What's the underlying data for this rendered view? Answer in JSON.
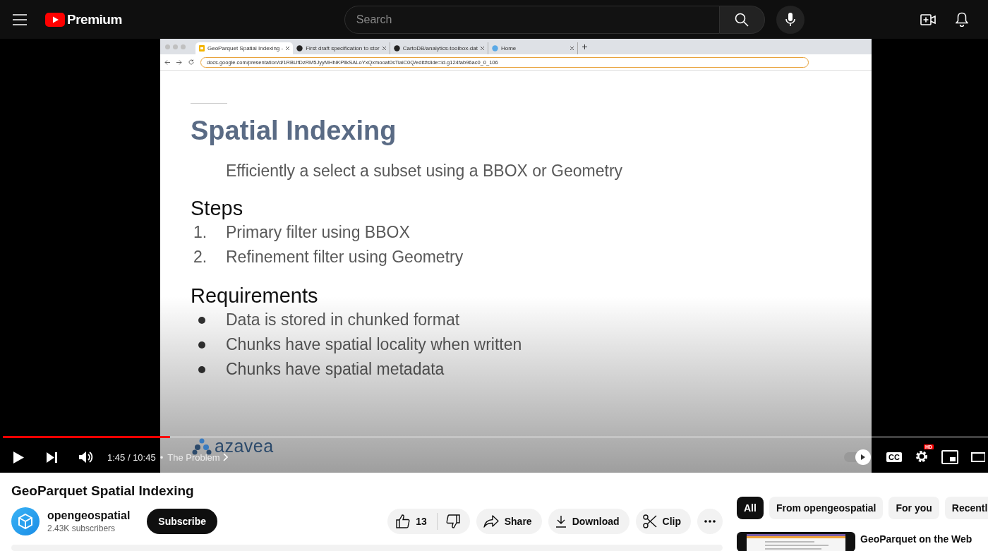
{
  "masthead": {
    "logo_text": "Premium",
    "search": {
      "placeholder": "Search"
    }
  },
  "player": {
    "browser": {
      "tabs": [
        {
          "title": "GeoParquet Spatial Indexing -",
          "selected": true
        },
        {
          "title": "First draft specification to stor",
          "selected": false
        },
        {
          "title": "CartoDB/analytics-toolbox-dat",
          "selected": false
        },
        {
          "title": "Home",
          "selected": false
        }
      ],
      "address": "docs.google.com/presentation/d/1RBUfDzRM5JyyMHhiKPllkSALoYxQxmooat0sTiaiC0Q/edit#slide=id.g124fab96ac0_0_106"
    },
    "slide": {
      "title": "Spatial Indexing",
      "subtitle": "Efficiently a select a subset using a BBOX or Geometry",
      "sections": [
        {
          "heading": "Steps",
          "kind": "numbered",
          "items": [
            {
              "marker": "1.",
              "text": "Primary filter using BBOX"
            },
            {
              "marker": "2.",
              "text": "Refinement filter using Geometry"
            }
          ]
        },
        {
          "heading": "Requirements",
          "kind": "bulleted",
          "items": [
            {
              "text": "Data is stored in chunked format"
            },
            {
              "text": "Chunks have spatial locality when written"
            },
            {
              "text": "Chunks have spatial metadata"
            }
          ]
        }
      ],
      "logo_text": "azavea"
    },
    "progress": {
      "level": 0.17
    },
    "time": "1:45 / 10:45",
    "chapter_separator": "•",
    "chapter": "The Problem",
    "autoplay_on": true,
    "captions_label": "CC",
    "quality_badge": "HD"
  },
  "video": {
    "title": "GeoParquet Spatial Indexing",
    "channel": {
      "name": "opengeospatial",
      "subscribers": "2.43K subscribers"
    },
    "subscribe_label": "Subscribe",
    "likes": "13",
    "actions": [
      {
        "kind": "share",
        "label": "Share"
      },
      {
        "kind": "download",
        "label": "Download"
      },
      {
        "kind": "clip",
        "label": "Clip"
      }
    ]
  },
  "related": {
    "chips": [
      {
        "label": "All",
        "selected": true
      },
      {
        "label": "From opengeospatial",
        "selected": false
      },
      {
        "label": "For you",
        "selected": false
      },
      {
        "label": "Recentl",
        "selected": false
      }
    ],
    "videos": [
      {
        "title": "GeoParquet on the Web"
      }
    ]
  }
}
